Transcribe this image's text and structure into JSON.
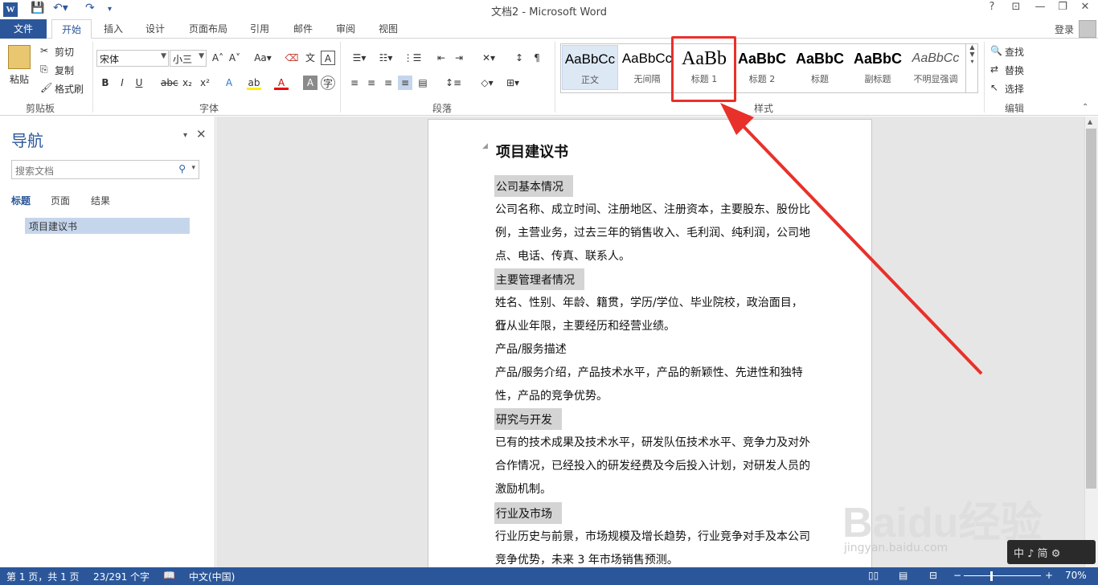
{
  "window": {
    "title": "文档2 - Microsoft Word",
    "help": "?",
    "controls": [
      "⊡",
      "—",
      "❐",
      "✕"
    ]
  },
  "quick_access": {
    "logo": "W"
  },
  "tabs": {
    "file": "文件",
    "items": [
      "开始",
      "插入",
      "设计",
      "页面布局",
      "引用",
      "邮件",
      "审阅",
      "视图"
    ],
    "active": "开始",
    "login": "登录"
  },
  "ribbon": {
    "clipboard": {
      "paste": "粘贴",
      "cut": "剪切",
      "copy": "复制",
      "format_painter": "格式刷",
      "label": "剪贴板"
    },
    "font": {
      "name": "宋体",
      "size": "小三",
      "label": "字体"
    },
    "paragraph": {
      "label": "段落"
    },
    "styles": {
      "label": "样式",
      "items": [
        {
          "preview": "AaBbCc",
          "name": "正文"
        },
        {
          "preview": "AaBbCc",
          "name": "无间隔"
        },
        {
          "preview": "AaBb",
          "name": "标题 1"
        },
        {
          "preview": "AaBbC",
          "name": "标题 2"
        },
        {
          "preview": "AaBbC",
          "name": "标题"
        },
        {
          "preview": "AaBbC",
          "name": "副标题"
        },
        {
          "preview": "AaBbCc",
          "name": "不明显强调"
        }
      ]
    },
    "editing": {
      "find": "查找",
      "replace": "替换",
      "select": "选择",
      "label": "编辑"
    }
  },
  "nav": {
    "title": "导航",
    "search_placeholder": "搜索文档",
    "tabs": [
      "标题",
      "页面",
      "结果"
    ],
    "headings": [
      "项目建议书"
    ]
  },
  "document": {
    "title": "项目建议书",
    "h1": "公司基本情况",
    "p1_l1": "公司名称、成立时间、注册地区、注册资本，主要股东、股份比",
    "p1_l2": "例，主营业务，过去三年的销售收入、毛利润、纯利润，公司地",
    "p1_l3": "点、电话、传真、联系人。",
    "h2": "主要管理者情况",
    "p2_l1": "姓名、性别、年龄、籍贯，学历/学位、毕业院校，政治面目，行",
    "p2_l2": "业从业年限，主要经历和经营业绩。",
    "p3": "产品/服务描述",
    "p4_l1": "产品/服务介绍，产品技术水平，产品的新颖性、先进性和独特",
    "p4_l2": "性，产品的竞争优势。",
    "h3": "研究与开发",
    "p5_l1": "已有的技术成果及技术水平，研发队伍技术水平、竞争力及对外",
    "p5_l2": "合作情况，已经投入的研发经费及今后投入计划，对研发人员的",
    "p5_l3": "激励机制。",
    "h4": "行业及市场",
    "p6_l1": "行业历史与前景，市场规模及增长趋势，行业竞争对手及本公司",
    "p6_l2": "竞争优势，未来 3 年市场销售预测。"
  },
  "status": {
    "page": "第 1 页，共 1 页",
    "words": "23/291 个字",
    "lang": "中文(中国)",
    "zoom": "70%"
  },
  "watermark": {
    "brand": "Baidu经验",
    "url": "jingyan.baidu.com"
  },
  "ime": "中 ♪ 简 ⚙"
}
